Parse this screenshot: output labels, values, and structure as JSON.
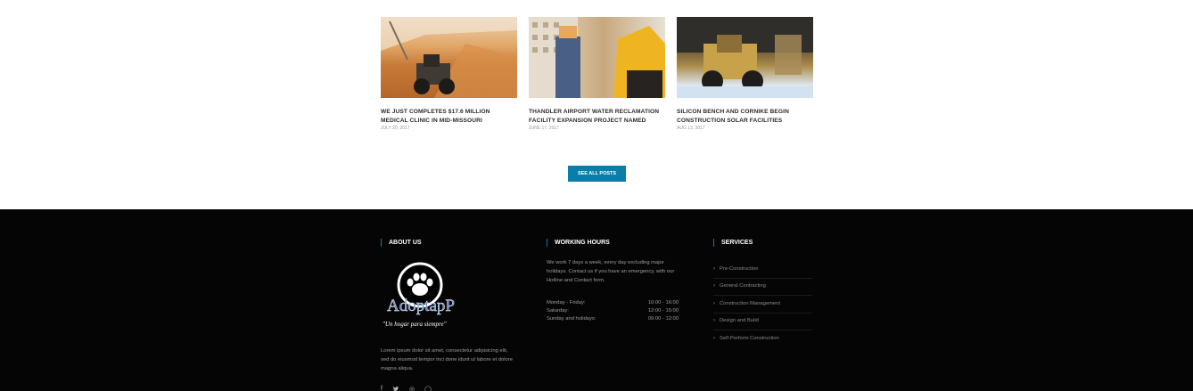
{
  "posts": [
    {
      "title": "WE JUST COMPLETES $17.6 MILLION MEDICAL CLINIC IN MID-MISSOURI",
      "date": "JULY 20, 2017"
    },
    {
      "title": "THANDLER AIRPORT WATER RECLAMATION FACILITY EXPANSION PROJECT NAMED",
      "date": "JUNE 17, 2017"
    },
    {
      "title": "SILICON BENCH AND CORNIKE BEGIN CONSTRUCTION SOLAR FACILITIES",
      "date": "AUG 13, 2017"
    }
  ],
  "see_all_label": "SEE ALL POSTS",
  "footer": {
    "about": {
      "heading": "ABOUT US",
      "logo_text": "AdoptapP",
      "logo_tagline": "\"Un hogar para siempre\"",
      "text": "Lorem ipsum dolor sit amet, consectetur adipisicing elit, sed do eiusmod tempor inci done idunt ut labore et dolore magna aliqua.",
      "social": [
        {
          "icon": "facebook-icon",
          "glyph": "f"
        },
        {
          "icon": "twitter-icon",
          "glyph": "t"
        },
        {
          "icon": "instagram-icon",
          "glyph": "◎"
        },
        {
          "icon": "github-icon",
          "glyph": "◯"
        }
      ]
    },
    "hours": {
      "heading": "WORKING HOURS",
      "text": "We work 7 days a week, every day excluding major holidays. Contact us if you have an emergency, with our Hotline and Contact form.",
      "rows": [
        {
          "day": "Monday - Friday:",
          "time": "10:00 - 16:00"
        },
        {
          "day": "Saturday:",
          "time": "12:00 - 15:00"
        },
        {
          "day": "Sunday and holidays:",
          "time": "09:00 - 12:00"
        }
      ]
    },
    "services": {
      "heading": "SERVICES",
      "items": [
        "Pre-Construction",
        "General Contracting",
        "Construction Management",
        "Design and Build",
        "Self-Perform Construction"
      ]
    }
  },
  "colors": {
    "accent": "#0a7ea8",
    "footer_bg": "#050505"
  }
}
